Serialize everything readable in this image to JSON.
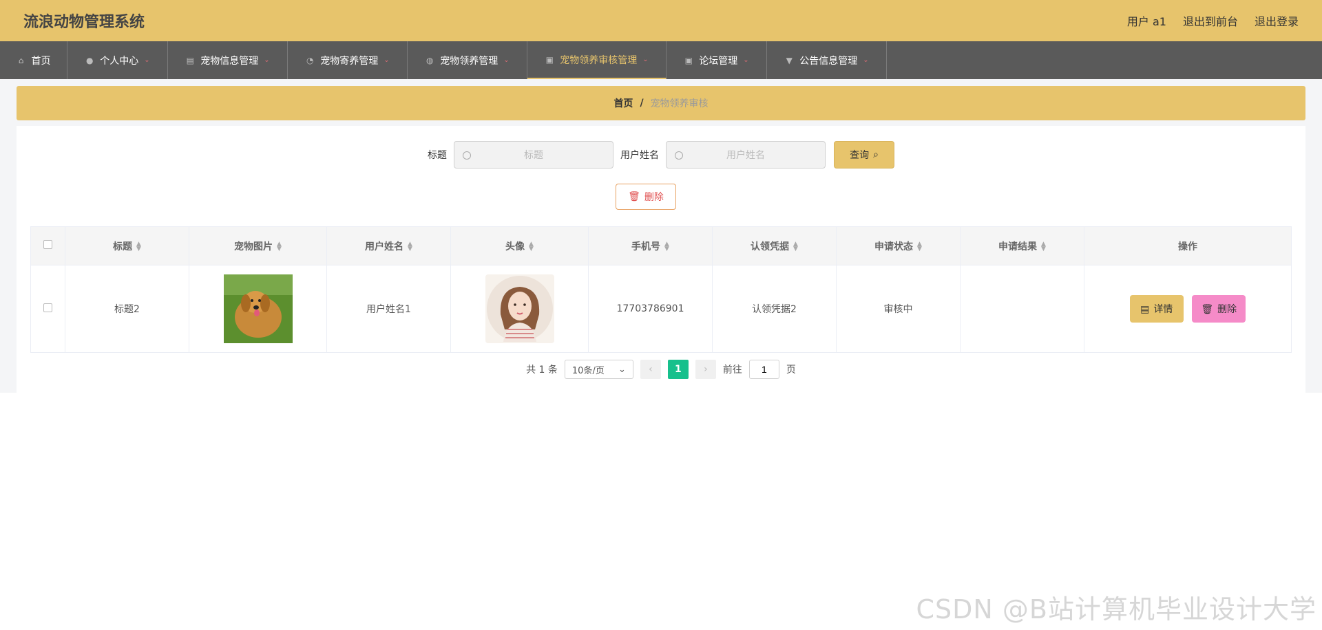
{
  "header": {
    "title": "流浪动物管理系统",
    "user_label": "用户 a1",
    "back_to_front": "退出到前台",
    "logout": "退出登录"
  },
  "nav": [
    {
      "label": "首页",
      "icon": "home-icon",
      "active": false
    },
    {
      "label": "个人中心",
      "icon": "user-icon",
      "active": false
    },
    {
      "label": "宠物信息管理",
      "icon": "chart-icon",
      "active": false
    },
    {
      "label": "宠物寄养管理",
      "icon": "bell-off-icon",
      "active": false
    },
    {
      "label": "宠物领养管理",
      "icon": "dashboard-icon",
      "active": false
    },
    {
      "label": "宠物领养审核管理",
      "icon": "clipboard-icon",
      "active": true
    },
    {
      "label": "论坛管理",
      "icon": "clipboard-check-icon",
      "active": false
    },
    {
      "label": "公告信息管理",
      "icon": "megaphone-icon",
      "active": false
    }
  ],
  "breadcrumb": {
    "home": "首页",
    "separator": "/",
    "current": "宠物领养审核"
  },
  "search": {
    "title_label": "标题",
    "title_placeholder": "标题",
    "username_label": "用户姓名",
    "username_placeholder": "用户姓名",
    "query_button": "查询"
  },
  "delete_button": "删除",
  "table": {
    "columns": [
      "标题",
      "宠物图片",
      "用户姓名",
      "头像",
      "手机号",
      "认领凭据",
      "申请状态",
      "申请结果",
      "操作"
    ],
    "rows": [
      {
        "title": "标题2",
        "username": "用户姓名1",
        "phone": "17703786901",
        "credential": "认领凭据2",
        "status": "审核中",
        "result": "",
        "detail_button": "详情",
        "delete_button": "删除"
      }
    ]
  },
  "pagination": {
    "total": "共 1 条",
    "page_size": "10条/页",
    "current_page": "1",
    "goto_label": "前往",
    "goto_value": "1",
    "page_suffix": "页"
  },
  "watermark": "CSDN @B站计算机毕业设计大学",
  "colors": {
    "accent": "#e7c46c",
    "nav_bg": "#5a5a5a",
    "pager_active": "#16c08c",
    "delete_pink": "#f58bc8"
  }
}
